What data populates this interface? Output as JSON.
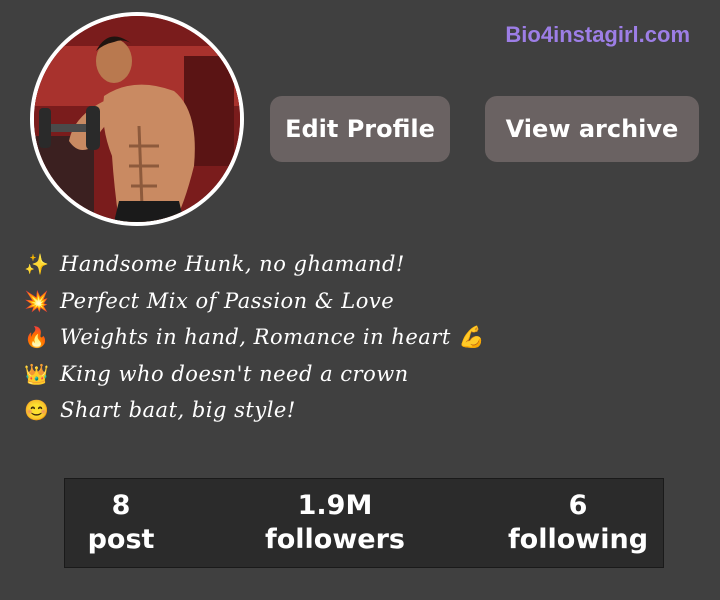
{
  "watermark": "Bio4instagirl.com",
  "profile": {
    "avatar_icon": "profile-photo"
  },
  "buttons": {
    "edit_profile": "Edit Profile",
    "view_archive": "View archive"
  },
  "bio": [
    {
      "emoji": "✨",
      "text": "Handsome Hunk, no ghamand!"
    },
    {
      "emoji": "💥",
      "text": "Perfect Mix of Passion & Love"
    },
    {
      "emoji": "🔥",
      "text": "Weights in hand, Romance in heart 💪"
    },
    {
      "emoji": "👑",
      "text": "King who doesn't need a crown"
    },
    {
      "emoji": "😊",
      "text": "Shart baat, big style!"
    }
  ],
  "stats": {
    "posts_count": "8",
    "posts_label": "post",
    "followers_count": "1.9M",
    "followers_label": "followers",
    "following_count": "6",
    "following_label": "following"
  },
  "colors": {
    "background": "#404040",
    "button": "#6a6262",
    "watermark": "#9d7ee6"
  }
}
